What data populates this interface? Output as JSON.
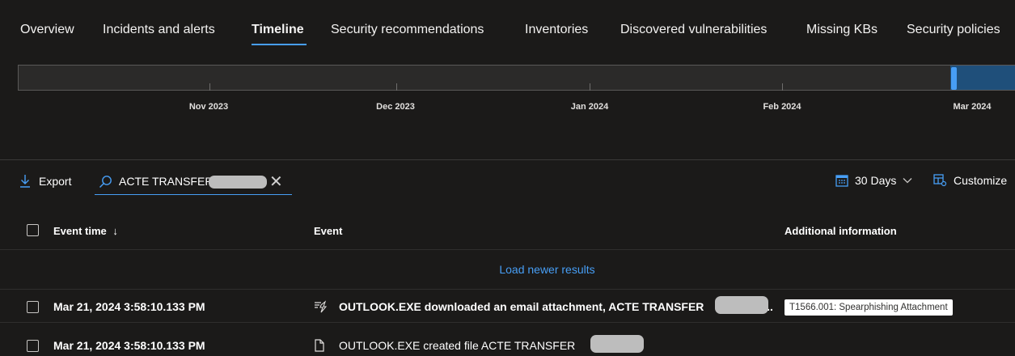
{
  "tabs": [
    {
      "label": "Overview"
    },
    {
      "label": "Incidents and alerts"
    },
    {
      "label": "Timeline"
    },
    {
      "label": "Security recommendations"
    },
    {
      "label": "Inventories"
    },
    {
      "label": "Discovered vulnerabilities"
    },
    {
      "label": "Missing KBs"
    },
    {
      "label": "Security policies"
    }
  ],
  "active_tab": "Timeline",
  "timeline": {
    "months": [
      "Nov 2023",
      "Dec 2023",
      "Jan 2024",
      "Feb 2024",
      "Mar 2024"
    ]
  },
  "toolbar": {
    "export_label": "Export",
    "search_value": "ACTE TRANSFER",
    "range_label": "30 Days",
    "customize_label": "Customize"
  },
  "table": {
    "columns": {
      "event_time": "Event time",
      "event": "Event",
      "additional_info": "Additional information"
    },
    "load_newer": "Load newer results",
    "rows": [
      {
        "time": "Mar 21, 2024 3:58:10.133 PM",
        "event_prefix": "OUTLOOK.EXE downloaded an email attachment, ACTE TRANSFER",
        "event_suffix": "...",
        "tag": "T1566.001: Spearphishing Attachment"
      },
      {
        "time": "Mar 21, 2024 3:58:10.133 PM",
        "event_prefix": "OUTLOOK.EXE created file ACTE TRANSFER",
        "event_suffix": "z"
      }
    ]
  },
  "colors": {
    "background": "#1b1a19",
    "accent": "#479ef5"
  }
}
